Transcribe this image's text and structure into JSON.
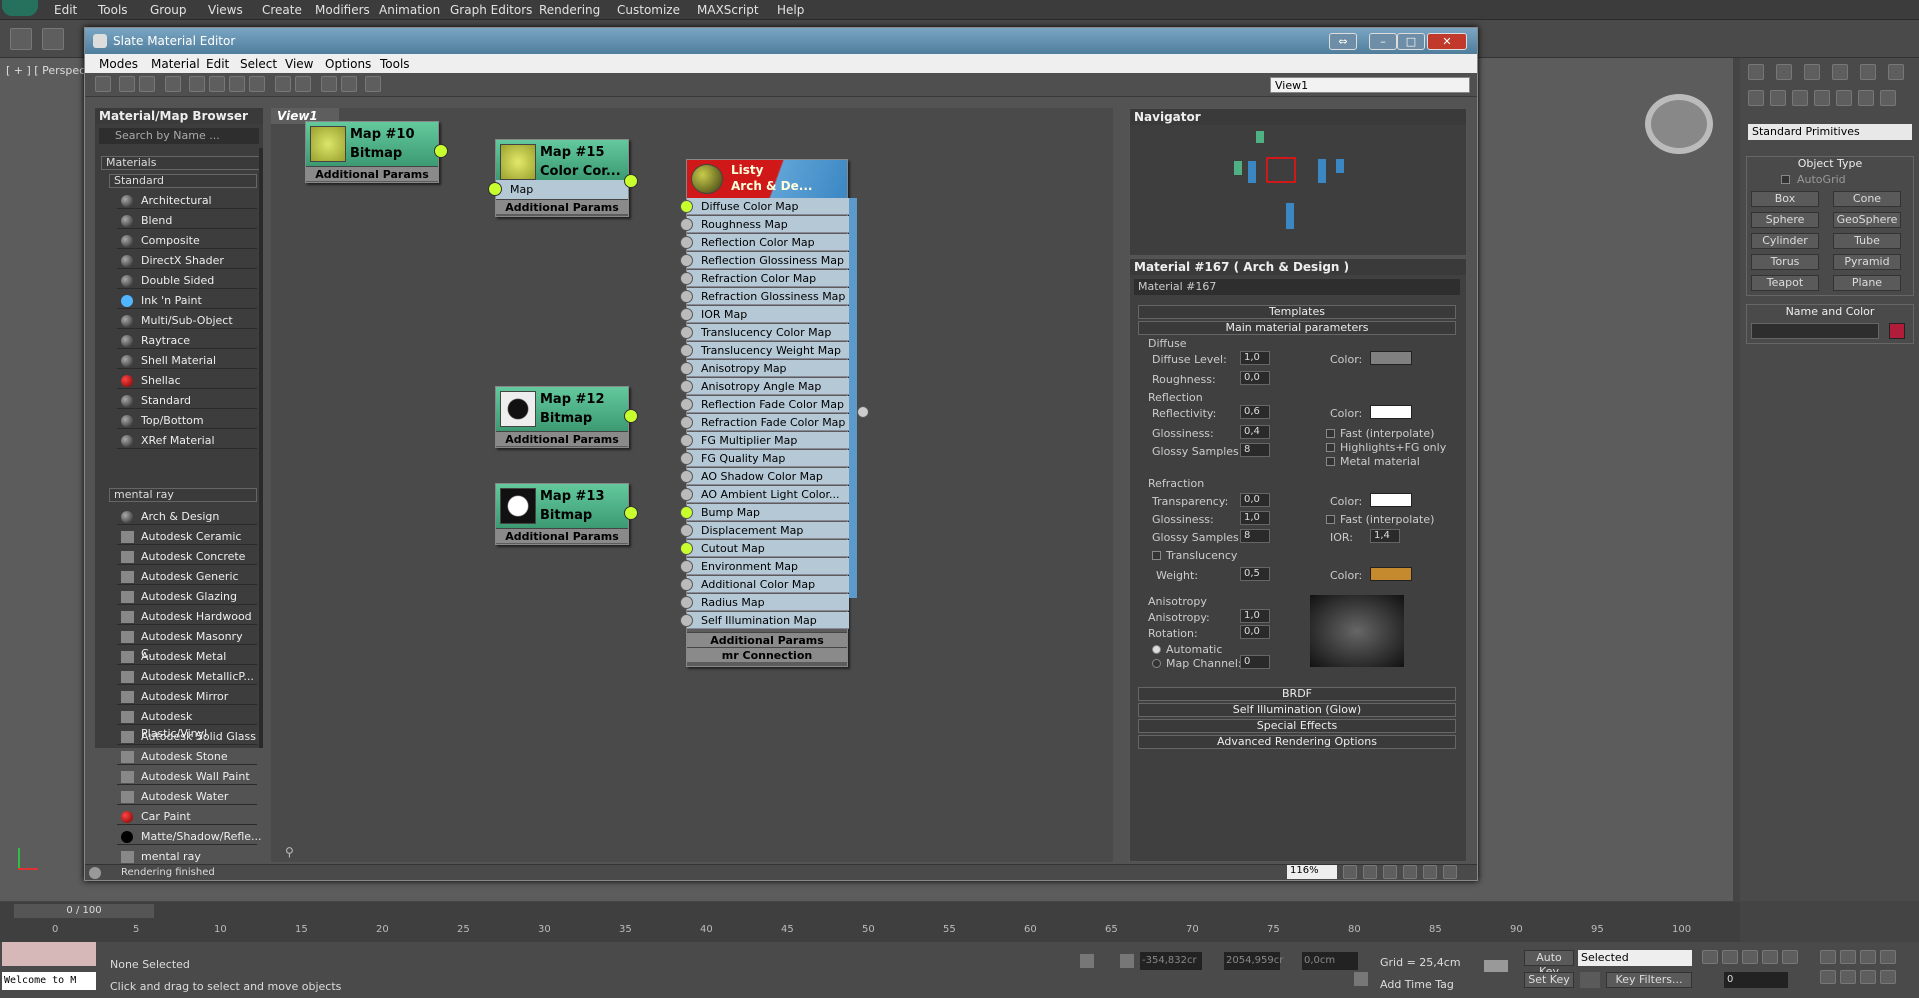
{
  "menubar": {
    "items": [
      "Edit",
      "Tools",
      "Group",
      "Views",
      "Create",
      "Modifiers",
      "Animation",
      "Graph Editors",
      "Rendering",
      "Customize",
      "MAXScript",
      "Help"
    ]
  },
  "viewport": {
    "label": "[ + ] [ Perspecti"
  },
  "sme": {
    "title": "Slate Material Editor",
    "menu": [
      "Modes",
      "Material",
      "Edit",
      "Select",
      "View",
      "Options",
      "Tools"
    ],
    "view_select": "View1",
    "browser": {
      "title": "Material/Map Browser",
      "search": "Search by Name ...",
      "group_materials": "Materials",
      "group_standard": "Standard",
      "standard_items": [
        "Architectural",
        "Blend",
        "Composite",
        "DirectX Shader",
        "Double Sided",
        "Ink 'n Paint",
        "Multi/Sub-Object",
        "Raytrace",
        "Shell Material",
        "Shellac",
        "Standard",
        "Top/Bottom",
        "XRef Material"
      ],
      "group_mentalray": "mental ray",
      "mr_items": [
        "Arch & Design",
        "Autodesk Ceramic",
        "Autodesk Concrete",
        "Autodesk Generic",
        "Autodesk Glazing",
        "Autodesk Hardwood",
        "Autodesk Masonry C...",
        "Autodesk Metal",
        "Autodesk MetallicP...",
        "Autodesk Mirror",
        "Autodesk Plastic/Vinyl",
        "Autodesk Solid Glass",
        "Autodesk Stone",
        "Autodesk Wall Paint",
        "Autodesk Water",
        "Car Paint",
        "Matte/Shadow/Refle...",
        "mental ray"
      ]
    },
    "view_tab": "View1",
    "nodes": {
      "n10": {
        "t1": "Map #10",
        "t2": "Bitmap",
        "params": "Additional Params"
      },
      "n15": {
        "t1": "Map #15",
        "t2": "Color Cor...",
        "slot": "Map",
        "params": "Additional Params"
      },
      "n12": {
        "t1": "Map #12",
        "t2": "Bitmap",
        "params": "Additional Params"
      },
      "n13": {
        "t1": "Map #13",
        "t2": "Bitmap",
        "params": "Additional Params"
      },
      "main": {
        "t1": "Listy",
        "t2": "Arch & De...",
        "params": "Additional Params",
        "mrconn": "mr Connection",
        "slots": [
          "Diffuse Color Map",
          "Roughness Map",
          "Reflection Color Map",
          "Reflection Glossiness Map",
          "Refraction Color Map",
          "Refraction Glossiness Map",
          "IOR Map",
          "Translucency Color Map",
          "Translucency Weight Map",
          "Anisotropy Map",
          "Anisotropy Angle Map",
          "Reflection Fade Color Map",
          "Refraction Fade Color Map",
          "FG Multiplier Map",
          "FG Quality Map",
          "AO Shadow Color Map",
          "AO Ambient Light Color...",
          "Bump Map",
          "Displacement Map",
          "Cutout Map",
          "Environment Map",
          "Additional Color Map",
          "Radius Map",
          "Self Illumination Map"
        ]
      }
    },
    "navigator": "Navigator",
    "params": {
      "title": "Material #167  ( Arch & Design )",
      "name": "Material #167",
      "templates": "Templates",
      "main": "Main material parameters",
      "diffuse": "Diffuse",
      "diffuse_level": "Diffuse Level:",
      "diffuse_level_v": "1,0",
      "color": "Color:",
      "roughness": "Roughness:",
      "roughness_v": "0,0",
      "reflection": "Reflection",
      "reflectivity": "Reflectivity:",
      "reflectivity_v": "0,6",
      "glossiness": "Glossiness:",
      "refl_gloss_v": "0,4",
      "glossy_samples": "Glossy Samples:",
      "refl_samples_v": "8",
      "fast": "Fast (interpolate)",
      "highlights": "Highlights+FG only",
      "metal": "Metal material",
      "refraction": "Refraction",
      "transparency": "Transparency:",
      "transparency_v": "0,0",
      "refr_gloss_v": "1,0",
      "refr_samples_v": "8",
      "ior": "IOR:",
      "ior_v": "1,4",
      "translucency": "Translucency",
      "weight": "Weight:",
      "weight_v": "0,5",
      "anisotropy": "Anisotropy",
      "anisotropy_l": "Anisotropy:",
      "anisotropy_v": "1,0",
      "rotation": "Rotation:",
      "rotation_v": "0,0",
      "automatic": "Automatic",
      "map_channel": "Map Channel:",
      "map_channel_v": "0",
      "brdf": "BRDF",
      "selfillum": "Self Illumination (Glow)",
      "special": "Special Effects",
      "adv": "Advanced Rendering Options"
    },
    "status": "Rendering finished",
    "zoom": "116%"
  },
  "rightpanel": {
    "dropdown": "Standard Primitives",
    "objtype": "Object Type",
    "autogrid": "AutoGrid",
    "buttons": [
      "Box",
      "Cone",
      "Sphere",
      "GeoSphere",
      "Cylinder",
      "Tube",
      "Torus",
      "Pyramid",
      "Teapot",
      "Plane"
    ],
    "namecolor": "Name and Color"
  },
  "timeline": {
    "frame": "0 / 100",
    "ticks": [
      "0",
      "5",
      "10",
      "15",
      "20",
      "25",
      "30",
      "35",
      "40",
      "45",
      "50",
      "55",
      "60",
      "65",
      "70",
      "75",
      "80",
      "85",
      "90",
      "95",
      "100"
    ]
  },
  "bottom": {
    "welcome": "Welcome to M",
    "none_selected": "None Selected",
    "hint": "Click and drag to select and move objects",
    "x": "-354,832cr",
    "y": "2054,959cr",
    "z": "0,0cm",
    "grid": "Grid = 25,4cm",
    "autokey": "Auto Key",
    "selected": "Selected",
    "setkey": "Set Key",
    "keyfilters": "Key Filters...",
    "addtimetag": "Add Time Tag",
    "frame_field": "0"
  },
  "colors": {
    "accent": "#3b87c4",
    "node_green": "#4fb083",
    "socket": "#c8ff2f",
    "wire": "#e03030",
    "translucency_swatch": "#c58a2e"
  }
}
